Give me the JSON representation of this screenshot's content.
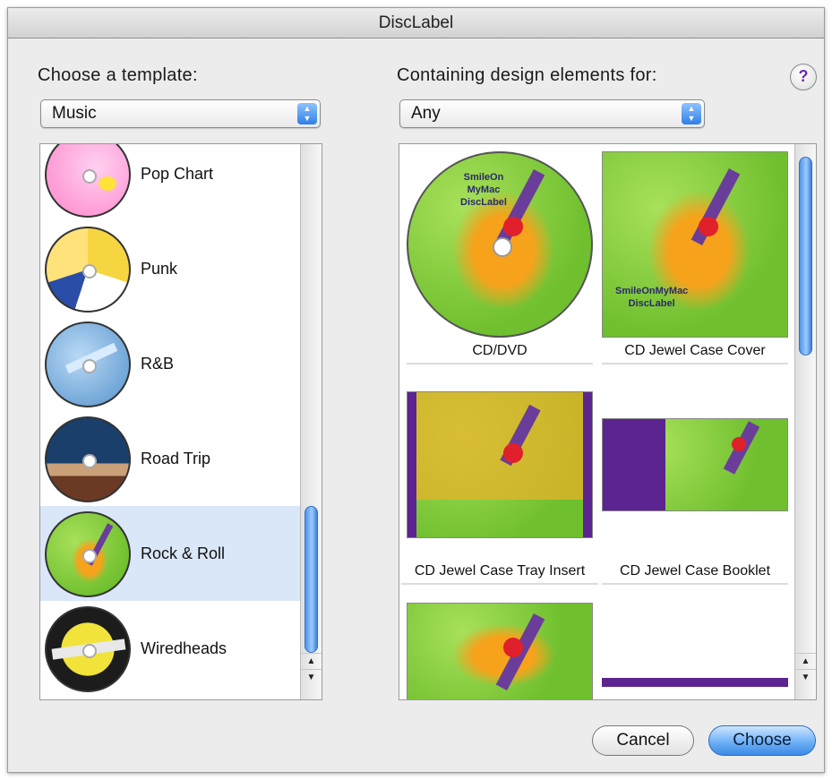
{
  "window": {
    "title": "DiscLabel"
  },
  "left": {
    "label": "Choose a template:",
    "dropdown_value": "Music",
    "templates": [
      {
        "name": "Pop Chart"
      },
      {
        "name": "Punk"
      },
      {
        "name": "R&B"
      },
      {
        "name": "Road Trip"
      },
      {
        "name": "Rock & Roll",
        "selected": true
      },
      {
        "name": "Wiredheads"
      }
    ]
  },
  "right": {
    "label": "Containing design elements for:",
    "dropdown_value": "Any",
    "help_label": "?",
    "items": [
      {
        "caption": "CD/DVD",
        "disc_text": [
          "SmileOn",
          "MyMac",
          "DiscLabel"
        ]
      },
      {
        "caption": "CD Jewel Case Cover",
        "cover_text": [
          "SmileOnMyMac",
          "DiscLabel"
        ]
      },
      {
        "caption": "CD Jewel Case Tray Insert"
      },
      {
        "caption": "CD Jewel Case Booklet"
      }
    ]
  },
  "buttons": {
    "cancel": "Cancel",
    "choose": "Choose"
  },
  "colors": {
    "accent": "#3b8ae6",
    "selection": "#d9e7f8",
    "purple": "#5b2490"
  }
}
